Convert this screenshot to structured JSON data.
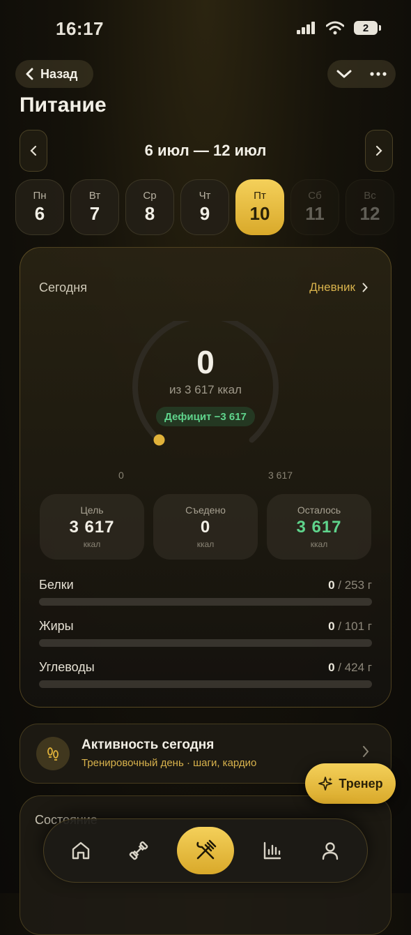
{
  "status_bar": {
    "time": "16:17",
    "battery": "2"
  },
  "header": {
    "back_label": "Назад",
    "title": "Питание"
  },
  "week": {
    "range": "6 июл — 12 июл"
  },
  "days": [
    {
      "name": "Пн",
      "num": "6"
    },
    {
      "name": "Вт",
      "num": "7"
    },
    {
      "name": "Ср",
      "num": "8"
    },
    {
      "name": "Чт",
      "num": "9"
    },
    {
      "name": "Пт",
      "num": "10"
    },
    {
      "name": "Сб",
      "num": "11"
    },
    {
      "name": "Вс",
      "num": "12"
    }
  ],
  "today": {
    "label": "Сегодня",
    "diary_link": "Дневник",
    "kcal_value": "0",
    "kcal_of": "из 3 617 ккал",
    "deficit": "Дефицит −3 617",
    "gauge_min": "0",
    "gauge_max": "3 617",
    "stats": [
      {
        "label": "Цель",
        "value": "3 617",
        "unit": "ккал"
      },
      {
        "label": "Съедено",
        "value": "0",
        "unit": "ккал"
      },
      {
        "label": "Осталось",
        "value": "3 617",
        "unit": "ккал"
      }
    ],
    "macros": [
      {
        "name": "Белки",
        "current": "0",
        "goal": " / 253 г"
      },
      {
        "name": "Жиры",
        "current": "0",
        "goal": " / 101 г"
      },
      {
        "name": "Углеводы",
        "current": "0",
        "goal": " / 424 г"
      }
    ]
  },
  "activity": {
    "title": "Активность сегодня",
    "subtitle": "Тренировочный день · шаги, кардио"
  },
  "coach_button": "Тренер",
  "section2_title": "Состояние",
  "colors": {
    "accent": "#f0c94a",
    "positive": "#5fd48c"
  },
  "tabs": [
    "home-icon",
    "dumbbell-icon",
    "fork-knife-icon",
    "bar-chart-icon",
    "profile-icon"
  ]
}
